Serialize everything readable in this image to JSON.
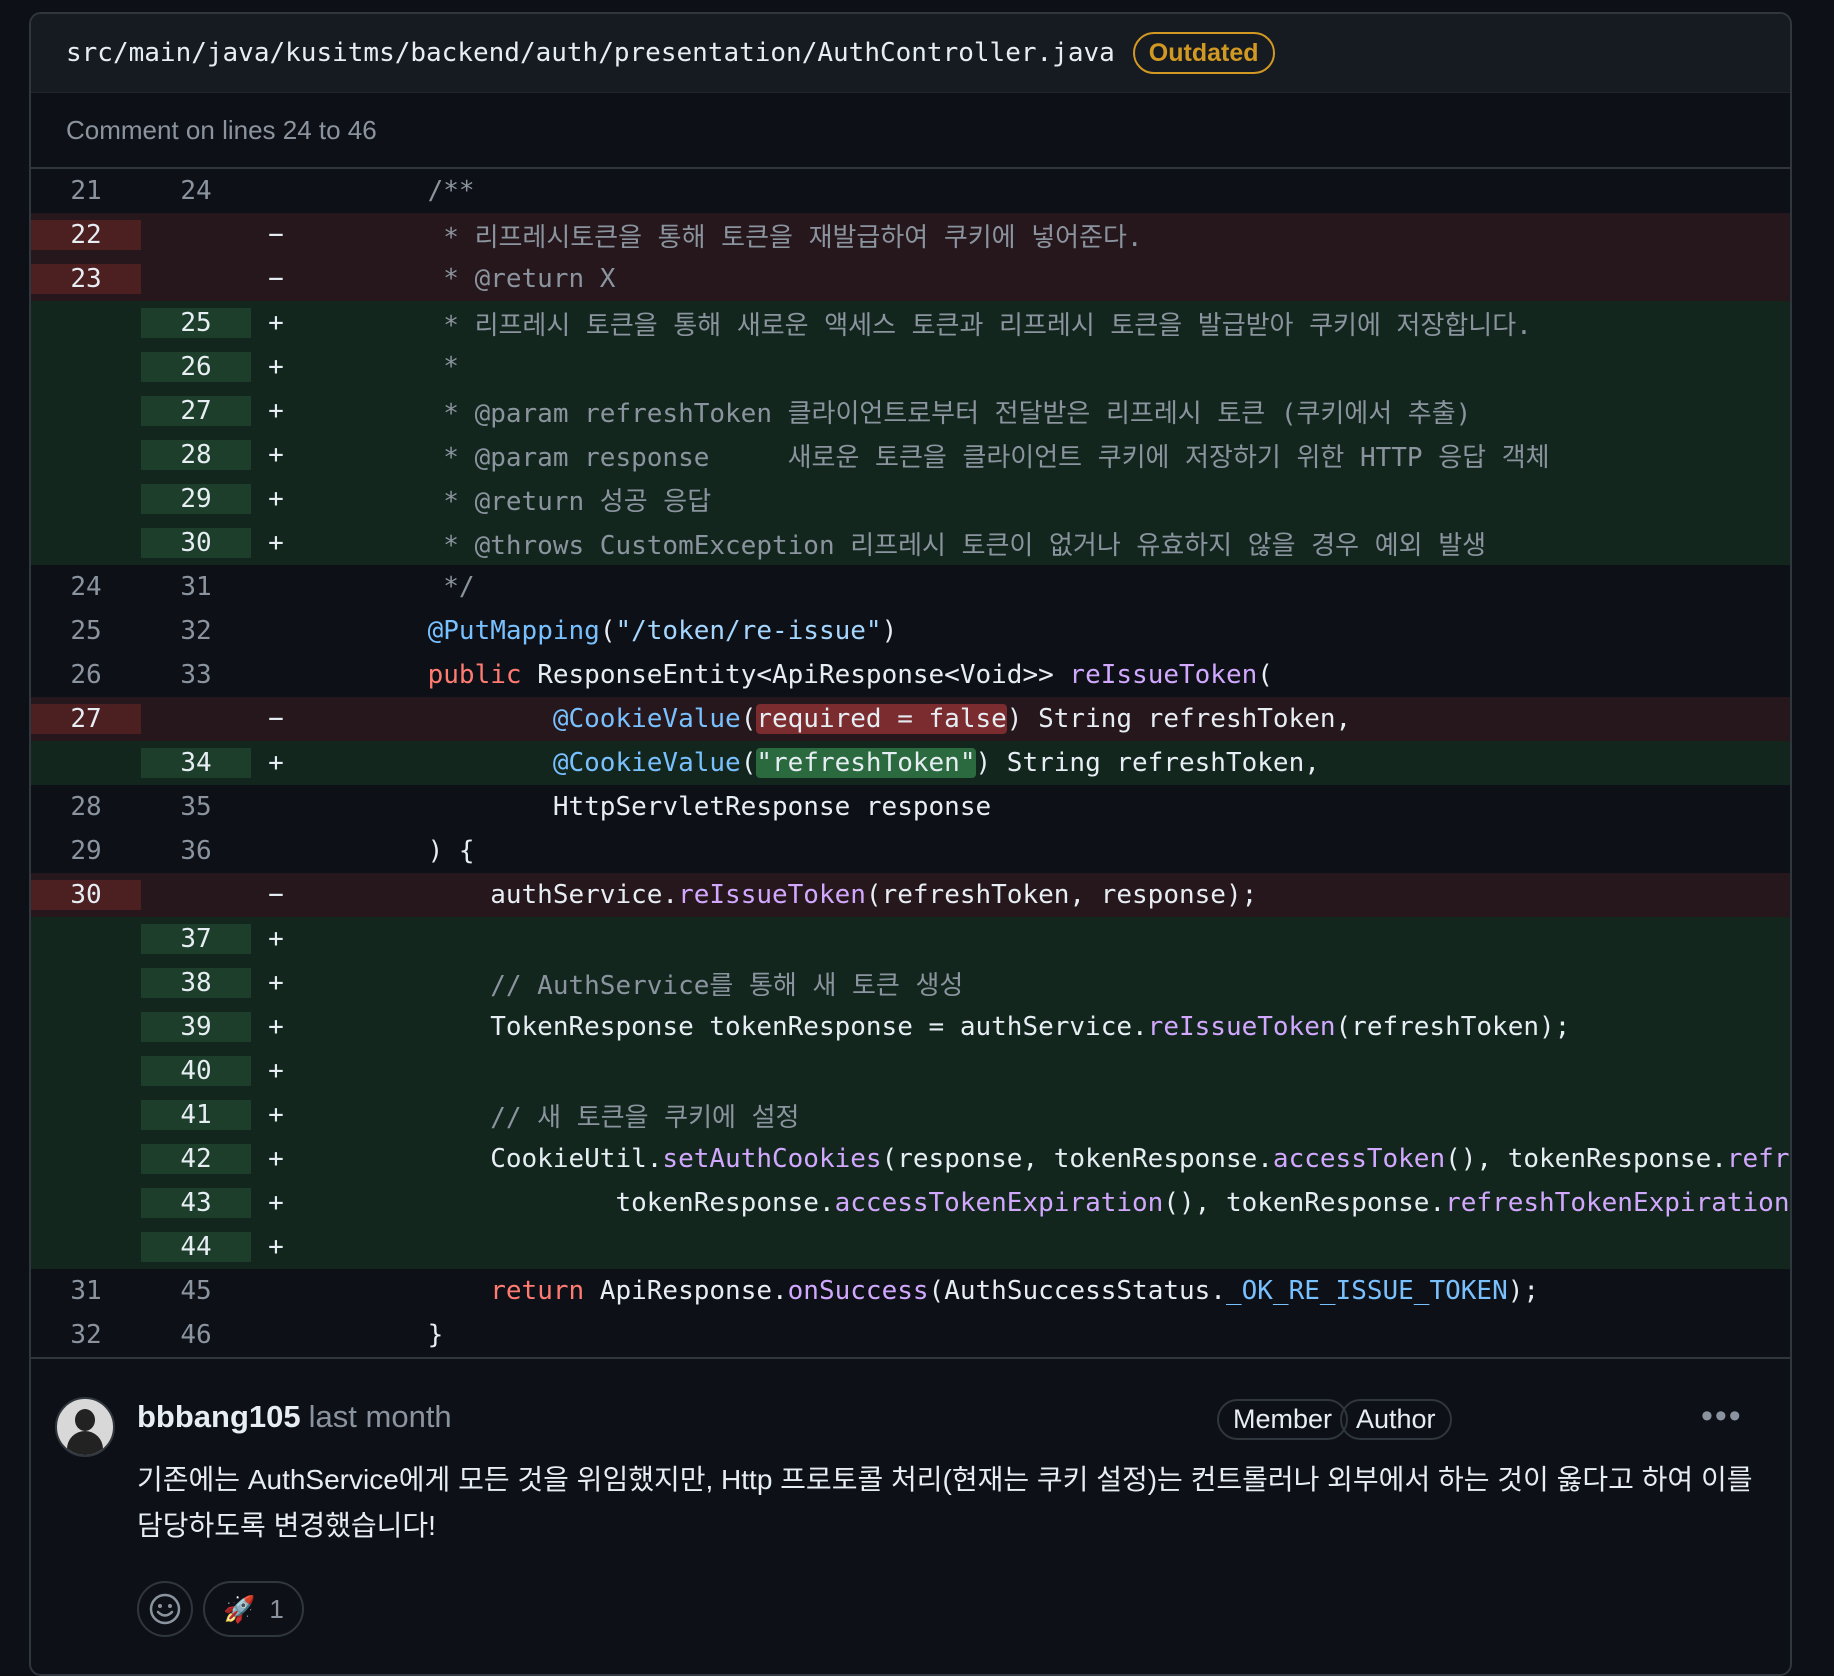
{
  "file": {
    "path": "src/main/java/kusitms/backend/auth/presentation/AuthController.java",
    "status_badge": "Outdated"
  },
  "comment_range": "Comment on lines 24 to 46",
  "diff": [
    {
      "type": "ctx",
      "old": "21",
      "new": "24",
      "sign": "",
      "tokens": [
        {
          "t": "    /**",
          "c": "comment"
        }
      ]
    },
    {
      "type": "del",
      "old": "22",
      "new": "",
      "sign": "−",
      "tokens": [
        {
          "t": "     * 리프레시토큰을 통해 토큰을 재발급하여 쿠키에 넣어준다.",
          "c": "comment"
        }
      ]
    },
    {
      "type": "del",
      "old": "23",
      "new": "",
      "sign": "−",
      "tokens": [
        {
          "t": "     * @return X",
          "c": "comment"
        }
      ]
    },
    {
      "type": "add",
      "old": "",
      "new": "25",
      "sign": "+",
      "tokens": [
        {
          "t": "     * 리프레시 토큰을 통해 새로운 액세스 토큰과 리프레시 토큰을 발급받아 쿠키에 저장합니다.",
          "c": "comment"
        }
      ]
    },
    {
      "type": "add",
      "old": "",
      "new": "26",
      "sign": "+",
      "tokens": [
        {
          "t": "     *",
          "c": "comment"
        }
      ]
    },
    {
      "type": "add",
      "old": "",
      "new": "27",
      "sign": "+",
      "tokens": [
        {
          "t": "     * @param refreshToken 클라이언트로부터 전달받은 리프레시 토큰 (쿠키에서 추출)",
          "c": "comment"
        }
      ]
    },
    {
      "type": "add",
      "old": "",
      "new": "28",
      "sign": "+",
      "tokens": [
        {
          "t": "     * @param response     새로운 토큰을 클라이언트 쿠키에 저장하기 위한 HTTP 응답 객체",
          "c": "comment"
        }
      ]
    },
    {
      "type": "add",
      "old": "",
      "new": "29",
      "sign": "+",
      "tokens": [
        {
          "t": "     * @return 성공 응답",
          "c": "comment"
        }
      ]
    },
    {
      "type": "add",
      "old": "",
      "new": "30",
      "sign": "+",
      "tokens": [
        {
          "t": "     * @throws CustomException 리프레시 토큰이 없거나 유효하지 않을 경우 예외 발생",
          "c": "comment"
        }
      ]
    },
    {
      "type": "ctx",
      "old": "24",
      "new": "31",
      "sign": "",
      "tokens": [
        {
          "t": "     */",
          "c": "comment"
        }
      ]
    },
    {
      "type": "ctx",
      "old": "25",
      "new": "32",
      "sign": "",
      "tokens": [
        {
          "t": "    ",
          "c": "plain"
        },
        {
          "t": "@PutMapping",
          "c": "ann"
        },
        {
          "t": "(",
          "c": "plain"
        },
        {
          "t": "\"/token/re-issue\"",
          "c": "str"
        },
        {
          "t": ")",
          "c": "plain"
        }
      ]
    },
    {
      "type": "ctx",
      "old": "26",
      "new": "33",
      "sign": "",
      "tokens": [
        {
          "t": "    ",
          "c": "plain"
        },
        {
          "t": "public",
          "c": "kw"
        },
        {
          "t": " ResponseEntity<ApiResponse<Void>> ",
          "c": "plain"
        },
        {
          "t": "reIssueToken",
          "c": "fn"
        },
        {
          "t": "(",
          "c": "plain"
        }
      ]
    },
    {
      "type": "del",
      "old": "27",
      "new": "",
      "sign": "−",
      "tokens": [
        {
          "t": "            ",
          "c": "plain"
        },
        {
          "t": "@CookieValue",
          "c": "ann"
        },
        {
          "t": "(",
          "c": "plain"
        },
        {
          "t": "required = false",
          "c": "plain",
          "hl": "del"
        },
        {
          "t": ") String refreshToken,",
          "c": "plain"
        }
      ]
    },
    {
      "type": "add",
      "old": "",
      "new": "34",
      "sign": "+",
      "tokens": [
        {
          "t": "            ",
          "c": "plain"
        },
        {
          "t": "@CookieValue",
          "c": "ann"
        },
        {
          "t": "(",
          "c": "plain"
        },
        {
          "t": "\"refreshToken\"",
          "c": "plain",
          "hl": "add"
        },
        {
          "t": ") String refreshToken,",
          "c": "plain"
        }
      ]
    },
    {
      "type": "ctx",
      "old": "28",
      "new": "35",
      "sign": "",
      "tokens": [
        {
          "t": "            HttpServletResponse response",
          "c": "plain"
        }
      ]
    },
    {
      "type": "ctx",
      "old": "29",
      "new": "36",
      "sign": "",
      "tokens": [
        {
          "t": "    ) {",
          "c": "plain"
        }
      ]
    },
    {
      "type": "del",
      "old": "30",
      "new": "",
      "sign": "−",
      "tokens": [
        {
          "t": "        authService.",
          "c": "plain"
        },
        {
          "t": "reIssueToken",
          "c": "fn"
        },
        {
          "t": "(refreshToken, response);",
          "c": "plain"
        }
      ]
    },
    {
      "type": "add",
      "old": "",
      "new": "37",
      "sign": "+",
      "tokens": []
    },
    {
      "type": "add",
      "old": "",
      "new": "38",
      "sign": "+",
      "tokens": [
        {
          "t": "        // AuthService를 통해 새 토큰 생성",
          "c": "comment"
        }
      ]
    },
    {
      "type": "add",
      "old": "",
      "new": "39",
      "sign": "+",
      "tokens": [
        {
          "t": "        TokenResponse tokenResponse = authService.",
          "c": "plain"
        },
        {
          "t": "reIssueToken",
          "c": "fn"
        },
        {
          "t": "(refreshToken);",
          "c": "plain"
        }
      ]
    },
    {
      "type": "add",
      "old": "",
      "new": "40",
      "sign": "+",
      "tokens": []
    },
    {
      "type": "add",
      "old": "",
      "new": "41",
      "sign": "+",
      "tokens": [
        {
          "t": "        // 새 토큰을 쿠키에 설정",
          "c": "comment"
        }
      ]
    },
    {
      "type": "add",
      "old": "",
      "new": "42",
      "sign": "+",
      "tokens": [
        {
          "t": "        CookieUtil.",
          "c": "plain"
        },
        {
          "t": "setAuthCookies",
          "c": "fn"
        },
        {
          "t": "(response, tokenResponse.",
          "c": "plain"
        },
        {
          "t": "accessToken",
          "c": "fn"
        },
        {
          "t": "(), tokenResponse.",
          "c": "plain"
        },
        {
          "t": "refresh",
          "c": "fn"
        }
      ]
    },
    {
      "type": "add",
      "old": "",
      "new": "43",
      "sign": "+",
      "tokens": [
        {
          "t": "                tokenResponse.",
          "c": "plain"
        },
        {
          "t": "accessTokenExpiration",
          "c": "fn"
        },
        {
          "t": "(), tokenResponse.",
          "c": "plain"
        },
        {
          "t": "refreshTokenExpiration",
          "c": "fn"
        },
        {
          "t": "())",
          "c": "plain"
        }
      ]
    },
    {
      "type": "add",
      "old": "",
      "new": "44",
      "sign": "+",
      "tokens": []
    },
    {
      "type": "ctx",
      "old": "31",
      "new": "45",
      "sign": "",
      "tokens": [
        {
          "t": "        ",
          "c": "plain"
        },
        {
          "t": "return",
          "c": "kw"
        },
        {
          "t": " ApiResponse.",
          "c": "plain"
        },
        {
          "t": "onSuccess",
          "c": "fn"
        },
        {
          "t": "(AuthSuccessStatus.",
          "c": "plain"
        },
        {
          "t": "_OK_RE_ISSUE_TOKEN",
          "c": "ann"
        },
        {
          "t": ");",
          "c": "plain"
        }
      ]
    },
    {
      "type": "ctx",
      "old": "32",
      "new": "46",
      "sign": "",
      "tokens": [
        {
          "t": "    }",
          "c": "plain"
        }
      ]
    }
  ],
  "comment": {
    "author": "bbbang105",
    "time": "last month",
    "badges": [
      "Member",
      "Author"
    ],
    "more_icon": "kebab-horizontal-icon",
    "body": "기존에는 AuthService에게 모든 것을 위임했지만, Http 프로토콜 처리(현재는 쿠키 설정)는 컨트롤러나 외부에서 하는 것이 옳다고 하여 이를 담당하도록 변경했습니다!",
    "reactions": {
      "add_icon": "smiley-icon",
      "rocket_emoji": "🚀",
      "rocket_count": "1"
    }
  },
  "colors": {
    "background": "#0d1117",
    "deleted_line": "#25171c",
    "added_line": "#12261e",
    "outdated": "#d29922",
    "keyword": "#ff7b72",
    "function": "#d2a8ff",
    "annotation": "#79c0ff",
    "comment": "#8b949e"
  }
}
